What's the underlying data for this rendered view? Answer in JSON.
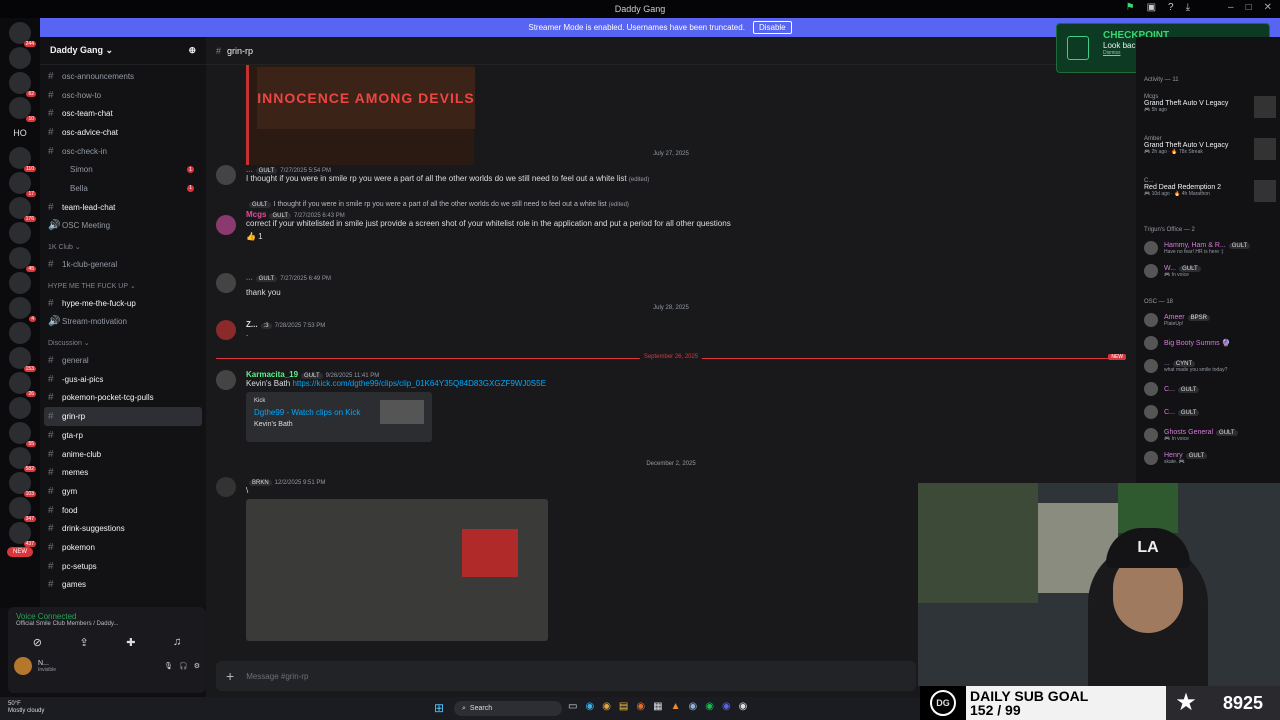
{
  "window": {
    "title": "Daddy Gang"
  },
  "banner": {
    "text": "Streamer Mode is enabled. Usernames have been truncated.",
    "button": "Disable"
  },
  "servers": [
    {
      "badge": "244"
    },
    {
      "badge": ""
    },
    {
      "badge": "62"
    },
    {
      "badge": "10"
    },
    {
      "badge": "",
      "text": "HO"
    },
    {
      "badge": "110"
    },
    {
      "badge": "17"
    },
    {
      "badge": "176"
    },
    {
      "badge": ""
    },
    {
      "badge": "45"
    },
    {
      "badge": ""
    },
    {
      "badge": "4"
    },
    {
      "badge": ""
    },
    {
      "badge": "153"
    },
    {
      "badge": "26"
    },
    {
      "badge": ""
    },
    {
      "badge": "55"
    },
    {
      "badge": "582"
    },
    {
      "badge": "103"
    },
    {
      "badge": "347"
    },
    {
      "badge": "437"
    }
  ],
  "servers_new": "NEW",
  "guild": {
    "name": "Daddy Gang ⌄"
  },
  "channels": [
    {
      "name": "osc-announcements",
      "kind": "ch"
    },
    {
      "name": "osc-how-to",
      "kind": "ch"
    },
    {
      "name": "osc-team-chat",
      "kind": "ch",
      "bold": true
    },
    {
      "name": "osc-advice-chat",
      "kind": "ch",
      "bold": true
    },
    {
      "name": "osc-check-in",
      "kind": "ch"
    },
    {
      "name": "Simon",
      "kind": "sub",
      "unread": "1"
    },
    {
      "name": "Bella",
      "kind": "sub",
      "unread": "1"
    },
    {
      "name": "team-lead-chat",
      "kind": "ch",
      "bold": true
    },
    {
      "name": "OSC Meeting",
      "kind": "voice"
    },
    {
      "name": "1K Club ⌄",
      "kind": "cat"
    },
    {
      "name": "1k-club-general",
      "kind": "ch"
    },
    {
      "name": "HYPE ME THE FUCK UP ⌄",
      "kind": "cat"
    },
    {
      "name": "hype-me-the-fuck-up",
      "kind": "ch",
      "bold": true
    },
    {
      "name": "Stream-motivation",
      "kind": "voice"
    },
    {
      "name": "Discussion ⌄",
      "kind": "cat"
    },
    {
      "name": "general",
      "kind": "ch"
    },
    {
      "name": "-gus-ai-pics",
      "kind": "ch",
      "bold": true
    },
    {
      "name": "pokemon-pocket-tcg-pulls",
      "kind": "ch",
      "bold": true
    },
    {
      "name": "grin-rp",
      "kind": "ch",
      "selected": true
    },
    {
      "name": "gta-rp",
      "kind": "ch",
      "bold": true
    },
    {
      "name": "anime-club",
      "kind": "ch",
      "bold": true
    },
    {
      "name": "memes",
      "kind": "ch",
      "bold": true
    },
    {
      "name": "gym",
      "kind": "ch",
      "bold": true
    },
    {
      "name": "food",
      "kind": "ch",
      "bold": true
    },
    {
      "name": "drink-suggestions",
      "kind": "ch",
      "bold": true
    },
    {
      "name": "pokemon",
      "kind": "ch",
      "bold": true
    },
    {
      "name": "pc-setups",
      "kind": "ch",
      "bold": true
    },
    {
      "name": "games",
      "kind": "ch",
      "bold": true
    }
  ],
  "voice_panel": {
    "status": "Voice Connected",
    "channel": "Official Smile Club Members / Daddy..."
  },
  "me": {
    "name": "N...",
    "status": "Invisible"
  },
  "channel_header": {
    "name": "grin-rp"
  },
  "embed_top": {
    "text": "INNOCENCE AMONG DEVILS"
  },
  "messages": {
    "date1": "July 27, 2025",
    "m1": {
      "name": "...",
      "tag": "GULT",
      "time": "7/27/2025 5:54 PM",
      "text": "I thought if you were in smile rp you were a part of all the other worlds do we still need to feel out a white list",
      "edited": "(edited)"
    },
    "m2_reply": {
      "tag": "GULT",
      "text": "I thought if you were in smile rp you were a part of all the other worlds do we still need to feel out a white list",
      "edited": "(edited)"
    },
    "m2": {
      "name": "Mcgs",
      "tag": "GULT",
      "time": "7/27/2025 6:43 PM",
      "text": "correct if your whitelisted in smile just provide a screen shot of your whitelist role in the application and put a period for all other questions",
      "reaction": "👍 1"
    },
    "m3": {
      "name": "...",
      "tag": "GULT",
      "time": "7/27/2025 6:49 PM",
      "text": "thank you"
    },
    "date2": "July 28, 2025",
    "m4": {
      "name": "Z...",
      "tag": ":3",
      "time": "7/28/2025 7:53 PM",
      "text": "."
    },
    "new_sep": "September 26, 2025",
    "new_badge": "NEW",
    "m5": {
      "name": "Karmacita_19",
      "tag": "GULT",
      "time": "9/26/2025 11:41 PM",
      "text": "Kevin's Bath",
      "link": "https://kick.com/dgthe99/clips/clip_01K64Y35Q84D83GXGZF9WJ0S5E"
    },
    "kick_embed": {
      "provider": "Kick",
      "title": "Dgthe99 - Watch clips on Kick",
      "desc": "Kevin's Bath"
    },
    "date3": "December 2, 2025",
    "m6": {
      "name": "",
      "tag": "BRKN",
      "time": "12/2/2025 9:51 PM",
      "text": "\\"
    }
  },
  "composer": {
    "placeholder": "Message #grin-rp"
  },
  "checkpoint": {
    "title": "CHECKPOINT",
    "subtitle": "Look back at your 2025 on Discord",
    "dismiss": "Dismiss"
  },
  "activity": {
    "header": "Activity — 11",
    "items": [
      {
        "name": "Mcgs",
        "game": "Grand Theft Auto V Legacy",
        "meta": "🎮 5h ago"
      },
      {
        "name": "Amber",
        "game": "Grand Theft Auto V Legacy",
        "meta": "🎮 2h ago · 🔥 78x Streak"
      },
      {
        "name": "C...",
        "game": "Red Dead Redemption 2",
        "meta": "🎮 10d ago · 🔥 4h Marathon"
      }
    ]
  },
  "groups": {
    "trigun": "Trigun's Office — 2",
    "osc": "OSC — 18"
  },
  "members_trigun": [
    {
      "name": "Hammy, Ham & R...",
      "tag": "GULT",
      "status": "Have no fear! HR is here :)"
    },
    {
      "name": "W...",
      "tag": "GULT",
      "status": "🎮 In voice"
    }
  ],
  "members_osc": [
    {
      "name": "Ameer",
      "tag": "BPSR",
      "status": "PlateUp!"
    },
    {
      "name": "Big Booty Summs 🔮",
      "tag": "",
      "status": ""
    },
    {
      "name": "...",
      "tag": "CYNT",
      "status": "what made you smile today?"
    },
    {
      "name": "C...",
      "tag": "GULT",
      "status": ""
    },
    {
      "name": "C...",
      "tag": "GULT",
      "status": ""
    },
    {
      "name": "Ghosts General",
      "tag": "GULT",
      "status": "🎮 In voice"
    },
    {
      "name": "Henry",
      "tag": "GULT",
      "status": "skate. 🎮"
    }
  ],
  "overlay": {
    "goal_label": "DAILY SUB GOAL",
    "goal_progress": "152 / 99",
    "count": "8925"
  },
  "taskbar": {
    "weather_temp": "50°F",
    "weather_desc": "Mostly cloudy",
    "search": "Search"
  },
  "colors": {
    "accent": "#5865f2",
    "danger": "#da373c",
    "link": "#00a8fc",
    "mcgs": "#eb459f",
    "karmacita": "#57f287"
  }
}
